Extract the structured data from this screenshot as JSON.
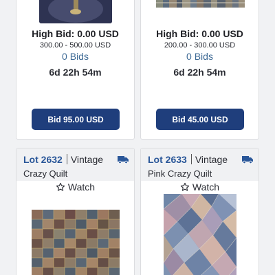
{
  "lots": [
    {
      "high_bid": "High Bid: 0.00 USD",
      "estimate": "300.00 - 500.00 USD",
      "bids": "0 Bids",
      "time_left": "6d 22h 54m",
      "bid_button": "Bid 95.00 USD"
    },
    {
      "high_bid": "High Bid: 0.00 USD",
      "estimate": "200.00 - 300.00 USD",
      "bids": "0 Bids",
      "time_left": "6d 22h 54m",
      "bid_button": "Bid 45.00 USD"
    },
    {
      "lot_number": "Lot 2632",
      "category": "Vintage",
      "title": "Crazy Quilt",
      "watch_label": "Watch",
      "shipping_icon": "truck-icon",
      "watch_icon": "star-outline-icon"
    },
    {
      "lot_number": "Lot 2633",
      "category": "Vintage",
      "title": "Pink Crazy Quilt",
      "watch_label": "Watch",
      "shipping_icon": "truck-icon",
      "watch_icon": "star-outline-icon"
    }
  ],
  "colors": {
    "button_bg": "#1f3e7c",
    "lot_link": "#2a5799",
    "bids_text": "#3e6a95"
  }
}
